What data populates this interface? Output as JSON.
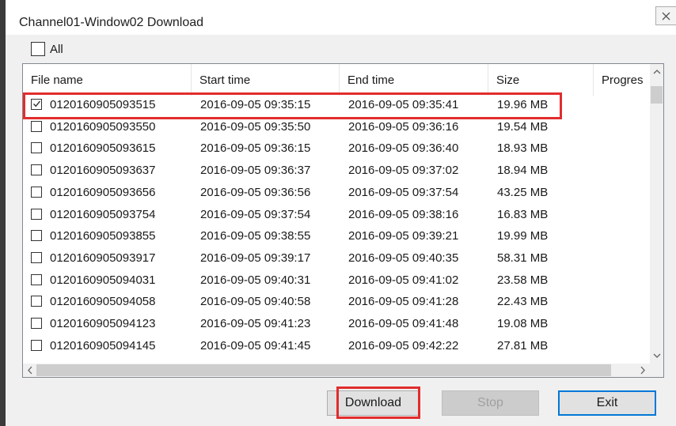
{
  "window": {
    "title": "Channel01-Window02 Download"
  },
  "all_checkbox": {
    "label": "All",
    "checked": false
  },
  "table": {
    "columns": [
      "File name",
      "Start time",
      "End time",
      "Size",
      "Progres"
    ],
    "rows": [
      {
        "checked": true,
        "name": "0120160905093515",
        "start": "2016-09-05 09:35:15",
        "end": "2016-09-05 09:35:41",
        "size": "19.96 MB",
        "progress": ""
      },
      {
        "checked": false,
        "name": "0120160905093550",
        "start": "2016-09-05 09:35:50",
        "end": "2016-09-05 09:36:16",
        "size": "19.54 MB",
        "progress": ""
      },
      {
        "checked": false,
        "name": "0120160905093615",
        "start": "2016-09-05 09:36:15",
        "end": "2016-09-05 09:36:40",
        "size": "18.93 MB",
        "progress": ""
      },
      {
        "checked": false,
        "name": "0120160905093637",
        "start": "2016-09-05 09:36:37",
        "end": "2016-09-05 09:37:02",
        "size": "18.94 MB",
        "progress": ""
      },
      {
        "checked": false,
        "name": "0120160905093656",
        "start": "2016-09-05 09:36:56",
        "end": "2016-09-05 09:37:54",
        "size": "43.25 MB",
        "progress": ""
      },
      {
        "checked": false,
        "name": "0120160905093754",
        "start": "2016-09-05 09:37:54",
        "end": "2016-09-05 09:38:16",
        "size": "16.83 MB",
        "progress": ""
      },
      {
        "checked": false,
        "name": "0120160905093855",
        "start": "2016-09-05 09:38:55",
        "end": "2016-09-05 09:39:21",
        "size": "19.99 MB",
        "progress": ""
      },
      {
        "checked": false,
        "name": "0120160905093917",
        "start": "2016-09-05 09:39:17",
        "end": "2016-09-05 09:40:35",
        "size": "58.31 MB",
        "progress": ""
      },
      {
        "checked": false,
        "name": "0120160905094031",
        "start": "2016-09-05 09:40:31",
        "end": "2016-09-05 09:41:02",
        "size": "23.58 MB",
        "progress": ""
      },
      {
        "checked": false,
        "name": "0120160905094058",
        "start": "2016-09-05 09:40:58",
        "end": "2016-09-05 09:41:28",
        "size": "22.43 MB",
        "progress": ""
      },
      {
        "checked": false,
        "name": "0120160905094123",
        "start": "2016-09-05 09:41:23",
        "end": "2016-09-05 09:41:48",
        "size": "19.08 MB",
        "progress": ""
      },
      {
        "checked": false,
        "name": "0120160905094145",
        "start": "2016-09-05 09:41:45",
        "end": "2016-09-05 09:42:22",
        "size": "27.81 MB",
        "progress": ""
      }
    ]
  },
  "buttons": {
    "download": "Download",
    "stop": "Stop",
    "exit": "Exit"
  },
  "icons": {
    "close": "close-icon",
    "scroll_up": "chevron-up-icon",
    "scroll_down": "chevron-down-icon",
    "scroll_left": "chevron-left-icon",
    "scroll_right": "chevron-right-icon",
    "check": "check-icon"
  },
  "colors": {
    "highlight": "#e12d2d",
    "default_button_border": "#0078d7"
  }
}
